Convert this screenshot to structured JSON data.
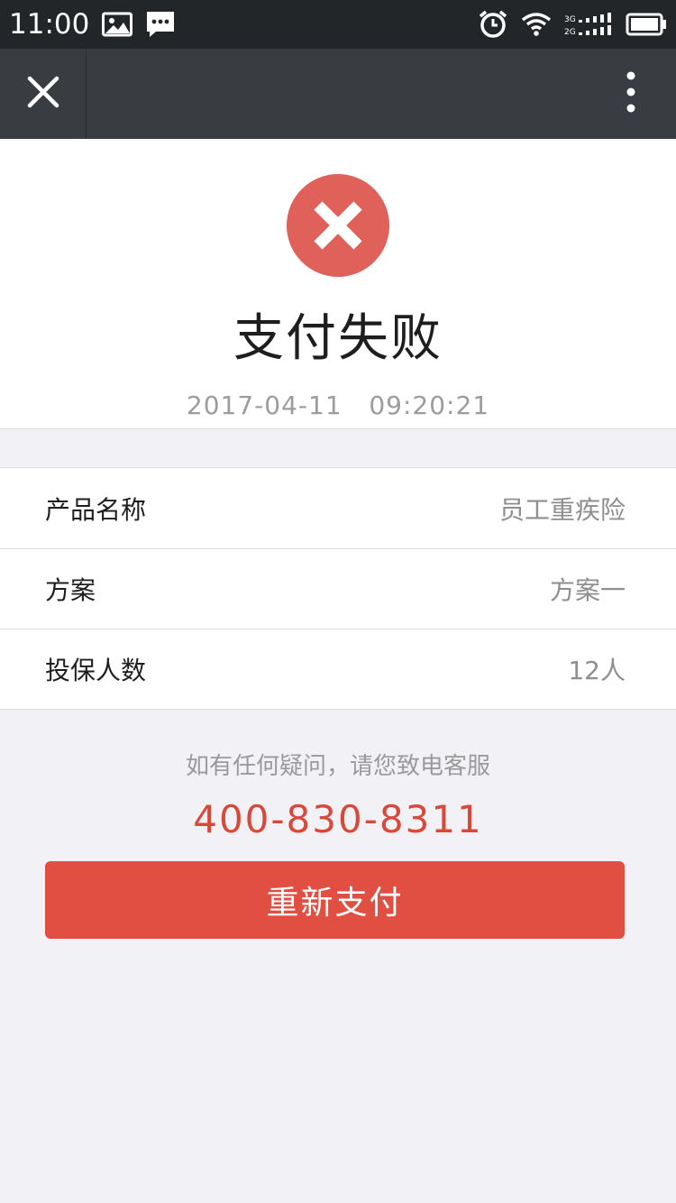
{
  "status_bar": {
    "time": "11:00",
    "icons_left": [
      "image-icon",
      "message-icon"
    ],
    "icons_right": [
      "alarm-icon",
      "wifi-icon",
      "signal-icon",
      "battery-icon"
    ]
  },
  "nav": {
    "close_icon": "close-icon",
    "menu_icon": "more-vertical-icon"
  },
  "result": {
    "icon": "error-circle-icon",
    "icon_color": "#e0605a",
    "title": "支付失败",
    "timestamp": "2017-04-11   09:20:21"
  },
  "details": [
    {
      "label": "产品名称",
      "value": "员工重疾险"
    },
    {
      "label": "方案",
      "value": "方案一"
    },
    {
      "label": "投保人数",
      "value": "12人"
    }
  ],
  "help": {
    "text": "如有任何疑问，请您致电客服",
    "phone": "400-830-8311"
  },
  "action": {
    "retry_label": "重新支付"
  },
  "colors": {
    "accent": "#e04f41",
    "nav_bg": "#393d41",
    "status_bg": "#232629"
  }
}
